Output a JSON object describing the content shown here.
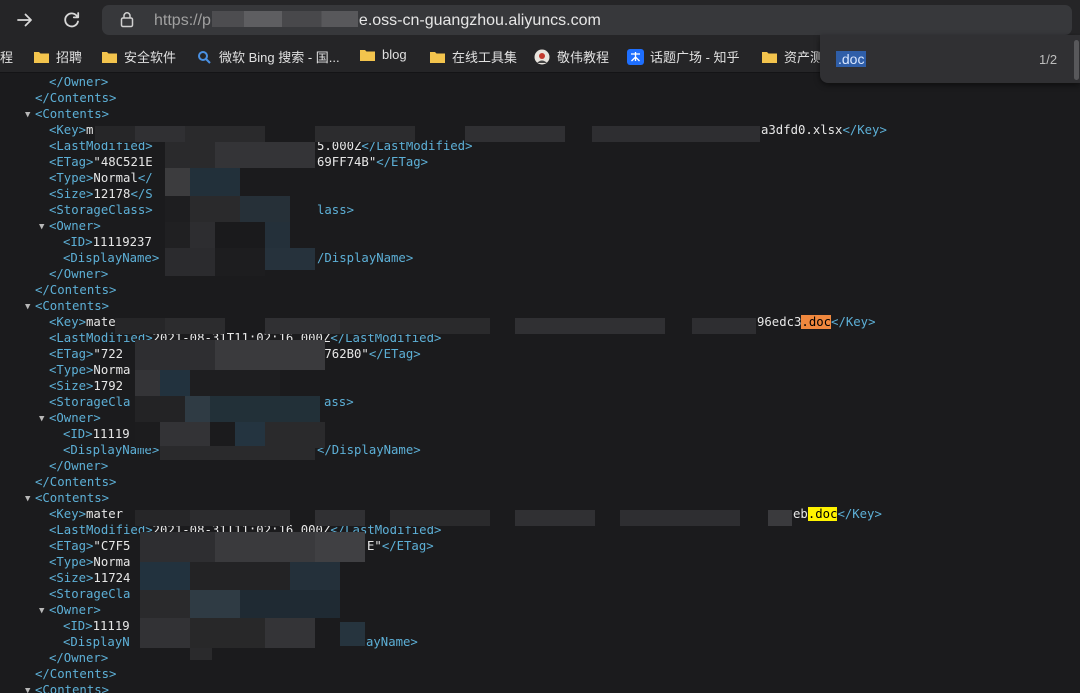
{
  "browser": {
    "url_scheme": "https://p",
    "url_host": "e.oss-cn-guangzhou.aliyuncs.com"
  },
  "bookmarks": [
    {
      "label": "程",
      "icon": "folder-icon"
    },
    {
      "label": "招聘",
      "icon": "folder-icon"
    },
    {
      "label": "安全软件",
      "icon": "folder-icon"
    },
    {
      "label": "微软 Bing 搜索 - 国...",
      "icon": "bing-icon"
    },
    {
      "label": "blog",
      "icon": "folder-icon"
    },
    {
      "label": "在线工具集",
      "icon": "folder-icon"
    },
    {
      "label": "敬伟教程",
      "icon": "avatar-icon"
    },
    {
      "label": "话题广场 - 知乎",
      "icon": "zhihu-icon"
    },
    {
      "label": "资产测",
      "icon": "folder-icon"
    }
  ],
  "find": {
    "query": ".doc",
    "count": "1/2"
  },
  "code": {
    "top": {
      "owner_close": "</Owner>",
      "contents_close": "</Contents>"
    },
    "blocks": [
      {
        "contents_open": "<Contents>",
        "key_open": "<Key>",
        "key_start": "m",
        "key_end": "a3dfd0.xlsx",
        "key_match": "",
        "key_close": "</Key>",
        "lm_open": "<LastModified>",
        "lm_value": "5.000Z",
        "lm_close": "</LastModified>",
        "etag_open": "<ETag>",
        "etag_start": "\"48C521E",
        "etag_end": "69FF74B\"",
        "etag_close": "</ETag>",
        "type_open": "<Type>",
        "type_value": "Normal",
        "type_close": "</",
        "size_open": "<Size>",
        "size_value": "12178",
        "size_close": "</S",
        "sc_open": "<StorageClass>",
        "sc_close": "lass>",
        "owner_open": "<Owner>",
        "id_open": "<ID>",
        "id_value": "11119237",
        "dn_open": "<DisplayName>",
        "dn_close": "/DisplayName>",
        "owner_close": "</Owner>",
        "contents_close": "</Contents>"
      },
      {
        "contents_open": "<Contents>",
        "key_open": "<Key>",
        "key_start": "mate",
        "key_end": "96edc3",
        "key_match": ".doc",
        "key_close": "</Key>",
        "lm_open": "<LastModified>",
        "lm_value": "2021-08-31T11:02:16.000Z",
        "lm_close": "</LastModified>",
        "etag_open": "<ETag>",
        "etag_start": "\"722",
        "etag_end": "7762B0\"",
        "etag_close": "</ETag>",
        "type_open": "<Type>",
        "type_value": "Norma",
        "type_close": "",
        "size_open": "<Size>",
        "size_value": "1792",
        "size_close": "",
        "sc_open": "<StorageCla",
        "sc_close": "ass>",
        "owner_open": "<Owner>",
        "id_open": "<ID>",
        "id_value": "11119",
        "dn_open": "<DisplayName>",
        "dn_close": "</DisplayName>",
        "owner_close": "</Owner>",
        "contents_close": "</Contents>"
      },
      {
        "contents_open": "<Contents>",
        "key_open": "<Key>",
        "key_start": "mater",
        "key_end": "eb",
        "key_match": ".doc",
        "key_close": "</Key>",
        "lm_open": "<LastModified>",
        "lm_value": "2021-08-31T11:02:16.000Z",
        "lm_close": "</LastModified>",
        "etag_open": "<ETag>",
        "etag_start": "\"C7F5",
        "etag_end": "E\"",
        "etag_close": "</ETag>",
        "type_open": "<Type>",
        "type_value": "Norma",
        "type_close": "",
        "size_open": "<Size>",
        "size_value": "11724",
        "size_close": "",
        "sc_open": "<StorageCla",
        "sc_close": "",
        "owner_open": "<Owner>",
        "id_open": "<ID>",
        "id_value": "11119",
        "dn_open": "<DisplayN",
        "dn_close": "ayName>",
        "owner_close": "</Owner>",
        "contents_close": "</Contents>"
      }
    ],
    "last_contents_open": "<Contents>"
  },
  "colors": {
    "tag": "#5db0d7",
    "text": "#e7e7e7",
    "current_match": "#f0883e",
    "match": "#fff300",
    "background": "#1b1b1d"
  }
}
